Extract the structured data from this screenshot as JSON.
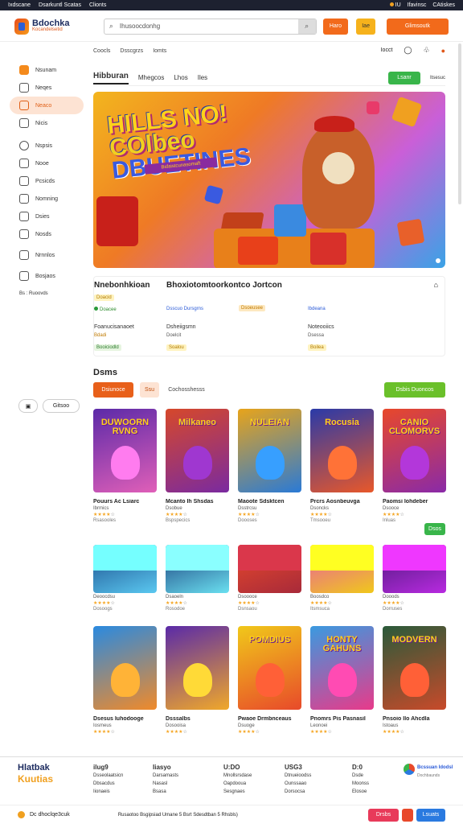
{
  "topbar": {
    "left": [
      "Ixdscane",
      "Dsarkuntl Scatas",
      "Clionts"
    ],
    "right": [
      "IU",
      "Ifavinsc",
      "CAtiskes"
    ]
  },
  "header": {
    "logo_title": "Bdochka",
    "logo_sub": "Kocandelsetid",
    "search_placeholder": "Ihusoocdonhg",
    "btn1": "Haro",
    "btn2": "Iae",
    "btn3": "Glimsoutk"
  },
  "subnav": [
    "Coocls",
    "Dsscgrzs",
    "Iomts"
  ],
  "utils": [
    "Iocct"
  ],
  "sidebar": {
    "items": [
      "Nsunam",
      "Neqes",
      "Neaco",
      "Nicis",
      "Nspsis",
      "Nooe",
      "Pcsicds",
      "Nomning",
      "Dsies",
      "Nosds",
      "Nrnnlos",
      "Bosjaos",
      "Bs : Ruoovds"
    ],
    "small_btn": "Gitsoo"
  },
  "tabs": {
    "active": "Hibburan",
    "items": [
      "Mhegcos",
      "Lhos",
      "Iles"
    ],
    "green_btn": "Lsanr",
    "more": "Itsesuc"
  },
  "hero": {
    "title_lines": [
      "HILLS NO!",
      "COlbeo",
      "DBUETINES"
    ],
    "subtitle": "Bsfaistcunasomaft"
  },
  "info": {
    "h1": "Nnebonhkioan",
    "h2": "Bhoxiotomtoorkontco Jortcon",
    "r1": [
      "Doacid",
      "Doacee",
      "Dsscuo Dursgrns",
      "Dsoeusee",
      "Ibdeana"
    ],
    "r2": [
      "Foanucisanaoet",
      "Dsheiigsmn",
      "Noteooiics"
    ],
    "r3": [
      "Bdadi",
      "Doelcit",
      "Dsessa"
    ],
    "r4": [
      "Booiciodld",
      "Soalou",
      "Boilea"
    ]
  },
  "section": {
    "title": "Dsms",
    "f1": "Dsiunoce",
    "f2": "Ssu",
    "f3": "Cochosshesss",
    "green": "Dsbis Duoncos"
  },
  "row1": [
    {
      "cap": "DUWOORN RVNG",
      "name": "Pouurs Ac Lsiarc",
      "genre": "Ibrmics",
      "plays": "Rsasooles",
      "c1": "#5b2aa8",
      "c2": "#e05fb8"
    },
    {
      "cap": "Milkaneo",
      "name": "Mcanto Ih Shsdas",
      "genre": "Dsobue",
      "plays": "Bspspecics",
      "c1": "#d6482a",
      "c2": "#7a2aa0"
    },
    {
      "cap": "NULEIAN",
      "name": "Maoote Sdsktcen",
      "genre": "Dsstrcsu",
      "plays": "Doooses",
      "c1": "#e8a41a",
      "c2": "#2a7ad6"
    },
    {
      "cap": "Rocusia",
      "name": "Prcrs Aosnbeuvga",
      "genre": "Dsoncks",
      "plays": "Tmsooeu",
      "c1": "#2a3aa8",
      "c2": "#e8582a"
    },
    {
      "cap": "CANIO CLOMORVS",
      "name": "Paomsi Iohdeber",
      "genre": "Dsooce",
      "plays": "Inluas",
      "c1": "#e8482a",
      "c2": "#8a2aa8"
    }
  ],
  "row1_badge": "Dsos",
  "row2": [
    {
      "genre": "Deoocdsu",
      "plays": "Dosoogs",
      "c1": "#1a4a8a",
      "c2": "#5ac8f0"
    },
    {
      "genre": "Dsaoeln",
      "plays": "Rosodoe",
      "c1": "#1a3a7a",
      "c2": "#6ae0f0"
    },
    {
      "genre": "Dsoooce",
      "plays": "Dsnsaou",
      "c1": "#e84a2a",
      "c2": "#a82a3a"
    },
    {
      "genre": "Boosdco",
      "plays": "Itsmsuca",
      "c1": "#e85aa8",
      "c2": "#f0c81a"
    },
    {
      "genre": "Dooods",
      "plays": "Dorruses",
      "c1": "#4a1a7a",
      "c2": "#b82ae0"
    }
  ],
  "row3": [
    {
      "cap": "",
      "name": "Dsesus Iuhodooge",
      "genre": "Iosmeus",
      "c1": "#2a8ae0",
      "c2": "#f08a2a"
    },
    {
      "cap": "",
      "name": "Dsssalbs",
      "genre": "Dosooisa",
      "c1": "#5a2aa8",
      "c2": "#f0a82a"
    },
    {
      "cap": "POMDIUS",
      "name": "Pwaoe Drmbnceaus",
      "genre": "Dsuoge",
      "c1": "#f0c81a",
      "c2": "#e84a2a"
    },
    {
      "cap": "HONTY GAHUNS",
      "name": "Pnomrs Pis Pasnasil",
      "genre": "Leonoei",
      "c1": "#3a9ae0",
      "c2": "#e83a8a"
    },
    {
      "cap": "MODVERN",
      "name": "Pnsoio Ilo Ahcdla",
      "genre": "Istoaus",
      "c1": "#2a5a3a",
      "c2": "#c84a2a"
    }
  ],
  "footer": {
    "brand1": "Hlatbak",
    "brand2": "Kuutias",
    "cols": [
      {
        "h": "ilug9",
        "items": [
          "Dsseolaatsicn",
          "Dbsacdus",
          "Iionaeis"
        ]
      },
      {
        "h": "Iiasyo",
        "items": [
          "Darsamasts",
          "Nasasl",
          "Bsasa"
        ]
      },
      {
        "h": "U:DO",
        "items": [
          "Mnollsrsdase",
          "Oapdooua",
          "Sesgnaes"
        ]
      },
      {
        "h": "USG3",
        "items": [
          "Dtnueioodss",
          "Ounssaao",
          "Dorsocsa"
        ]
      },
      {
        "h": "D:0",
        "items": [
          "Dsde",
          "Moonss",
          "Elosoe"
        ]
      }
    ],
    "badge_title": "Bcssuan Idodsl",
    "badge_sub": "Dochbaunds",
    "bottom_left": "Dc dhoclqe3cuk",
    "bottom_mid": "Rusaotoo Bsgipsiad Umane  5 Bsrt Sdesdtban  5 Rhsbls)",
    "b1": "Drsbs",
    "b2": "Lsuats"
  }
}
